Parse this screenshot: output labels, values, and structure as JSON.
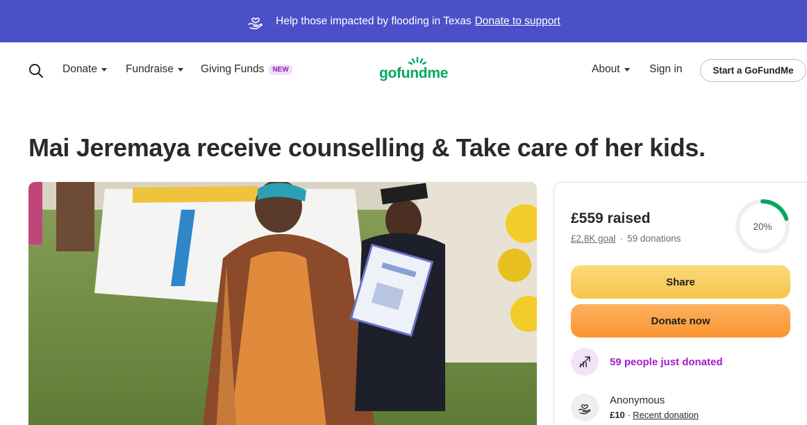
{
  "banner": {
    "text": "Help those impacted by flooding in Texas",
    "link": "Donate to support",
    "icon": "heart-hand-icon"
  },
  "nav": {
    "search_icon": "search-icon",
    "donate": "Donate",
    "fundraise": "Fundraise",
    "giving_funds": "Giving Funds",
    "new_badge": "NEW",
    "logo": "gofundme",
    "about": "About",
    "sign_in": "Sign in",
    "start": "Start a GoFundMe"
  },
  "campaign": {
    "title": "Mai Jeremaya receive counselling & Take care of her kids."
  },
  "card": {
    "raised": "£559 raised",
    "goal": "£2.8K goal",
    "separator": "·",
    "donations": "59 donations",
    "progress_label": "20%",
    "progress": 0.2,
    "share": "Share",
    "donate_now": "Donate now",
    "recent_activity": "59 people just donated",
    "donor_name": "Anonymous",
    "donor_amount": "£10",
    "donor_separator": "·",
    "donor_label": "Recent donation"
  },
  "colors": {
    "banner_bg": "#4b4fc8",
    "brand_green": "#02a95c",
    "share_yellow": "#f6c54a",
    "donate_orange": "#fb9530",
    "purple_accent": "#a21ccc"
  }
}
